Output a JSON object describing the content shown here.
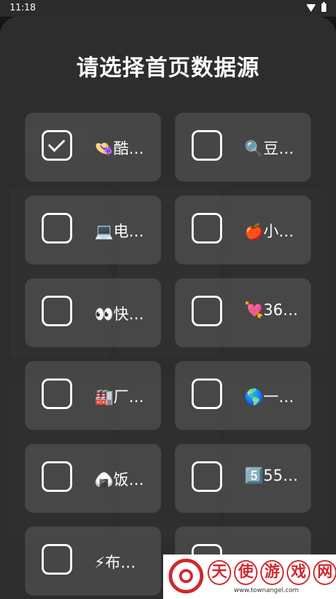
{
  "status_bar": {
    "time": "11:18"
  },
  "dialog": {
    "title": "请选择首页数据源",
    "sources": [
      {
        "label": "👒酷…",
        "checked": true
      },
      {
        "label": "🔍豆…",
        "checked": false
      },
      {
        "label": "💻电…",
        "checked": false
      },
      {
        "label": "🍎小…",
        "checked": false
      },
      {
        "label": "👀快…",
        "checked": false
      },
      {
        "label": "💘36…",
        "checked": false
      },
      {
        "label": "🏭厂…",
        "checked": false
      },
      {
        "label": "🌎一…",
        "checked": false
      },
      {
        "label": "🍙饭…",
        "checked": false
      },
      {
        "label": "5️⃣55…",
        "checked": false
      },
      {
        "label": "⚡布…",
        "checked": false
      },
      {
        "label": "",
        "checked": false
      }
    ]
  },
  "watermark": {
    "text": "天使游戏网",
    "url": "www.townangel.com"
  }
}
